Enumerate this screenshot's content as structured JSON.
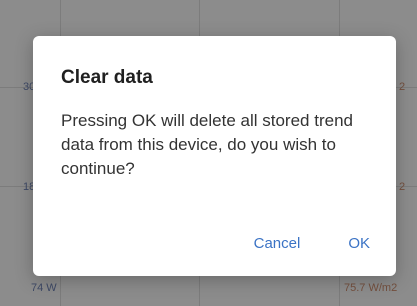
{
  "background_chart": {
    "left_labels": [
      "30",
      "18",
      "74 W"
    ],
    "right_labels": [
      "2",
      "2",
      "75.7 W/m2"
    ],
    "left_color": "#6c7fb0",
    "right_color": "#c98a6c"
  },
  "dialog": {
    "title": "Clear data",
    "message": "Pressing OK will delete all stored trend data from this device, do you wish to continue?",
    "cancel_label": "Cancel",
    "ok_label": "OK",
    "accent_color": "#3b73c5"
  }
}
